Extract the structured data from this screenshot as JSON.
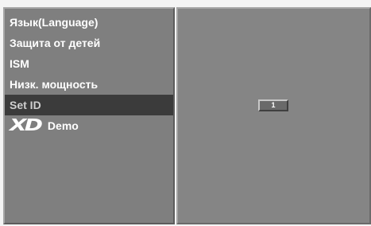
{
  "menu": {
    "items": [
      {
        "label": "Язык(Language)"
      },
      {
        "label": "Защита от детей"
      },
      {
        "label": "ISM"
      },
      {
        "label": "Низк. мощность"
      },
      {
        "label": "Set ID",
        "selected": true
      },
      {
        "label": "Demo",
        "logo": "XD"
      }
    ]
  },
  "set_id": {
    "value": "1"
  }
}
